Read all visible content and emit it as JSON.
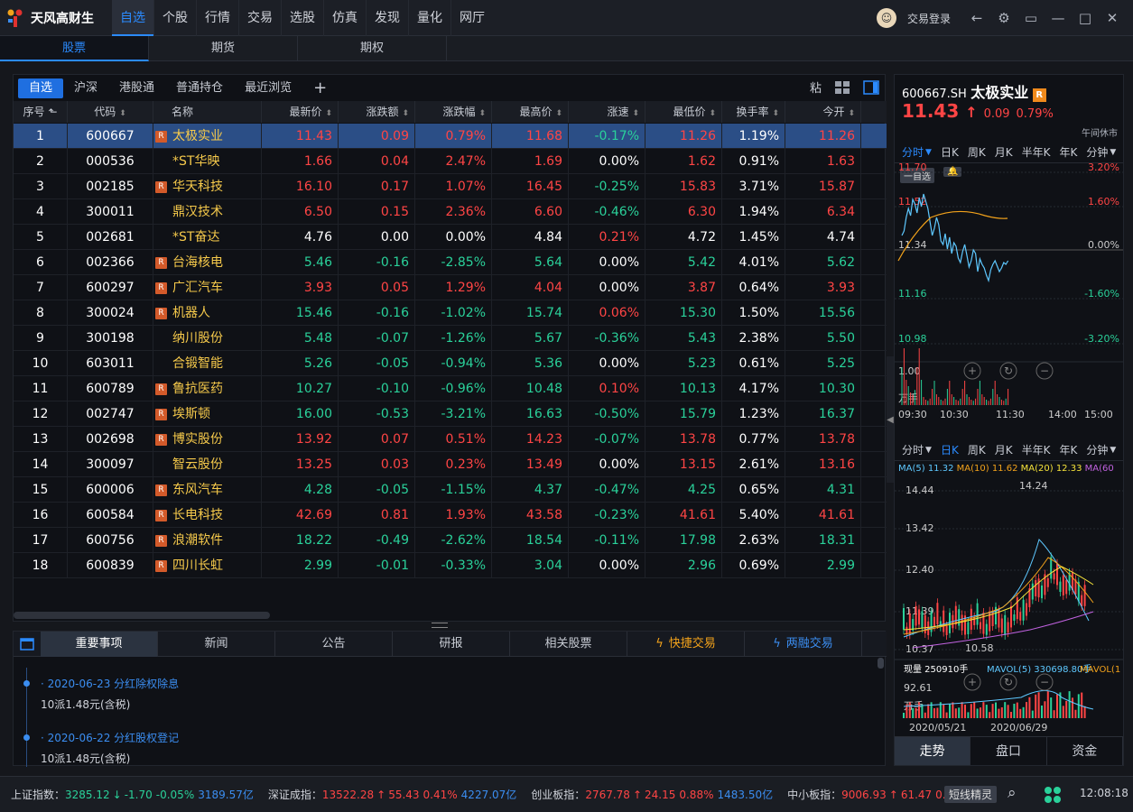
{
  "app": {
    "name": "天风高财生"
  },
  "nav": [
    "自选",
    "个股",
    "行情",
    "交易",
    "选股",
    "仿真",
    "发现",
    "量化",
    "网厅"
  ],
  "topright": {
    "login": "交易登录"
  },
  "subtabs": [
    "股票",
    "期货",
    "期权"
  ],
  "maintabs": [
    "自选",
    "沪深",
    "港股通",
    "普通持仓",
    "最近浏览",
    "+"
  ],
  "maintoolbar": {
    "paste": "粘"
  },
  "columns": [
    "序号",
    "代码",
    "名称",
    "最新价",
    "涨跌额",
    "涨跌幅",
    "最高价",
    "涨速",
    "最低价",
    "换手率",
    "今开"
  ],
  "rows": [
    {
      "n": "1",
      "code": "600667",
      "r": true,
      "name": "太极实业",
      "last": "11.43",
      "chg": "0.09",
      "pct": "0.79%",
      "high": "11.68",
      "spd": "-0.17%",
      "low": "11.26",
      "turn": "1.19%",
      "open": "11.26"
    },
    {
      "n": "2",
      "code": "000536",
      "r": false,
      "name": "*ST华映",
      "last": "1.66",
      "chg": "0.04",
      "pct": "2.47%",
      "high": "1.69",
      "spd": "0.00%",
      "low": "1.62",
      "turn": "0.91%",
      "open": "1.63"
    },
    {
      "n": "3",
      "code": "002185",
      "r": true,
      "name": "华天科技",
      "last": "16.10",
      "chg": "0.17",
      "pct": "1.07%",
      "high": "16.45",
      "spd": "-0.25%",
      "low": "15.83",
      "turn": "3.71%",
      "open": "15.87"
    },
    {
      "n": "4",
      "code": "300011",
      "r": false,
      "name": "鼎汉技术",
      "last": "6.50",
      "chg": "0.15",
      "pct": "2.36%",
      "high": "6.60",
      "spd": "-0.46%",
      "low": "6.30",
      "turn": "1.94%",
      "open": "6.34"
    },
    {
      "n": "5",
      "code": "002681",
      "r": false,
      "name": "*ST奋达",
      "last": "4.76",
      "chg": "0.00",
      "pct": "0.00%",
      "high": "4.84",
      "spd": "0.21%",
      "low": "4.72",
      "turn": "1.45%",
      "open": "4.74"
    },
    {
      "n": "6",
      "code": "002366",
      "r": true,
      "name": "台海核电",
      "last": "5.46",
      "chg": "-0.16",
      "pct": "-2.85%",
      "high": "5.64",
      "spd": "0.00%",
      "low": "5.42",
      "turn": "4.01%",
      "open": "5.62"
    },
    {
      "n": "7",
      "code": "600297",
      "r": true,
      "name": "广汇汽车",
      "last": "3.93",
      "chg": "0.05",
      "pct": "1.29%",
      "high": "4.04",
      "spd": "0.00%",
      "low": "3.87",
      "turn": "0.64%",
      "open": "3.93"
    },
    {
      "n": "8",
      "code": "300024",
      "r": true,
      "name": "机器人",
      "last": "15.46",
      "chg": "-0.16",
      "pct": "-1.02%",
      "high": "15.74",
      "spd": "0.06%",
      "low": "15.30",
      "turn": "1.50%",
      "open": "15.56"
    },
    {
      "n": "9",
      "code": "300198",
      "r": false,
      "name": "纳川股份",
      "last": "5.48",
      "chg": "-0.07",
      "pct": "-1.26%",
      "high": "5.67",
      "spd": "-0.36%",
      "low": "5.43",
      "turn": "2.38%",
      "open": "5.50"
    },
    {
      "n": "10",
      "code": "603011",
      "r": false,
      "name": "合锻智能",
      "last": "5.26",
      "chg": "-0.05",
      "pct": "-0.94%",
      "high": "5.36",
      "spd": "0.00%",
      "low": "5.23",
      "turn": "0.61%",
      "open": "5.25"
    },
    {
      "n": "11",
      "code": "600789",
      "r": true,
      "name": "鲁抗医药",
      "last": "10.27",
      "chg": "-0.10",
      "pct": "-0.96%",
      "high": "10.48",
      "spd": "0.10%",
      "low": "10.13",
      "turn": "4.17%",
      "open": "10.30"
    },
    {
      "n": "12",
      "code": "002747",
      "r": true,
      "name": "埃斯顿",
      "last": "16.00",
      "chg": "-0.53",
      "pct": "-3.21%",
      "high": "16.63",
      "spd": "-0.50%",
      "low": "15.79",
      "turn": "1.23%",
      "open": "16.37"
    },
    {
      "n": "13",
      "code": "002698",
      "r": true,
      "name": "博实股份",
      "last": "13.92",
      "chg": "0.07",
      "pct": "0.51%",
      "high": "14.23",
      "spd": "-0.07%",
      "low": "13.78",
      "turn": "0.77%",
      "open": "13.78"
    },
    {
      "n": "14",
      "code": "300097",
      "r": false,
      "name": "智云股份",
      "last": "13.25",
      "chg": "0.03",
      "pct": "0.23%",
      "high": "13.49",
      "spd": "0.00%",
      "low": "13.15",
      "turn": "2.61%",
      "open": "13.16"
    },
    {
      "n": "15",
      "code": "600006",
      "r": true,
      "name": "东风汽车",
      "last": "4.28",
      "chg": "-0.05",
      "pct": "-1.15%",
      "high": "4.37",
      "spd": "-0.47%",
      "low": "4.25",
      "turn": "0.65%",
      "open": "4.31"
    },
    {
      "n": "16",
      "code": "600584",
      "r": true,
      "name": "长电科技",
      "last": "42.69",
      "chg": "0.81",
      "pct": "1.93%",
      "high": "43.58",
      "spd": "-0.23%",
      "low": "41.61",
      "turn": "5.40%",
      "open": "41.61"
    },
    {
      "n": "17",
      "code": "600756",
      "r": true,
      "name": "浪潮软件",
      "last": "18.22",
      "chg": "-0.49",
      "pct": "-2.62%",
      "high": "18.54",
      "spd": "-0.11%",
      "low": "17.98",
      "turn": "2.63%",
      "open": "18.31"
    },
    {
      "n": "18",
      "code": "600839",
      "r": true,
      "name": "四川长虹",
      "last": "2.99",
      "chg": "-0.01",
      "pct": "-0.33%",
      "high": "3.04",
      "spd": "0.00%",
      "low": "2.96",
      "turn": "0.69%",
      "open": "2.99"
    }
  ],
  "bottomtabs": [
    "重要事项",
    "新闻",
    "公告",
    "研报",
    "相关股票",
    "快捷交易",
    "两融交易"
  ],
  "events": [
    {
      "date": "· 2020-06-23 分红除权除息",
      "desc": "10派1.48元(含税)"
    },
    {
      "date": "· 2020-06-22 分红股权登记",
      "desc": "10派1.48元(含税)"
    }
  ],
  "quote": {
    "code": "600667.SH",
    "name": "太极实业",
    "price": "11.43",
    "arrow": "↑",
    "chg": "0.09",
    "pct": "0.79%",
    "status": "午间休市",
    "add": "一自选"
  },
  "intraday": {
    "tabs": [
      "分时",
      "日K",
      "周K",
      "月K",
      "半年K",
      "年K",
      "分钟"
    ],
    "y_left": [
      "11.70",
      "11.52",
      "11.34",
      "11.16",
      "10.98"
    ],
    "y_right": [
      "3.20%",
      "1.60%",
      "0.00%",
      "-1.60%",
      "-3.20%"
    ],
    "vol_label": "1.00",
    "vol_unit": "万手",
    "x": [
      "09:30",
      "10:30",
      "11:30",
      "14:00",
      "15:00"
    ]
  },
  "kline": {
    "tabs": [
      "分时",
      "日K",
      "周K",
      "月K",
      "半年K",
      "年K",
      "分钟"
    ],
    "ma5": "MA(5) 11.32",
    "ma10": "MA(10) 11.62",
    "ma20": "MA(20) 12.33",
    "ma60": "MA(60",
    "y": [
      "14.44",
      "13.42",
      "12.40",
      "11.39",
      "10.37"
    ],
    "hi": "14.24",
    "lo": "10.58",
    "vol": "现量 250910手",
    "mavol5": "MAVOL(5) 330698.80手",
    "mavol10": "MAVOL(1",
    "vy": "92.61",
    "vunit": "万手",
    "x": [
      "2020/05/21",
      "2020/06/29"
    ]
  },
  "rightbottom": [
    "走势",
    "盘口",
    "资金"
  ],
  "status": [
    {
      "name": "上证指数：",
      "val": "3285.12",
      "arrow": "↓",
      "chg": "-1.70",
      "pct": "-0.05%",
      "amt": "3189.57亿",
      "up": false
    },
    {
      "name": "深证成指：",
      "val": "13522.28",
      "arrow": "↑",
      "chg": "55.43",
      "pct": "0.41%",
      "amt": "4227.07亿",
      "up": true
    },
    {
      "name": "创业板指：",
      "val": "2767.78",
      "arrow": "↑",
      "chg": "24.15",
      "pct": "0.88%",
      "amt": "1483.50亿",
      "up": true
    },
    {
      "name": "中小板指：",
      "val": "9006.93",
      "arrow": "↑",
      "chg": "61.47",
      "pct": "0.69%",
      "amt": "",
      "up": true
    }
  ],
  "wizard": "短线精灵",
  "clock": "12:08:18"
}
